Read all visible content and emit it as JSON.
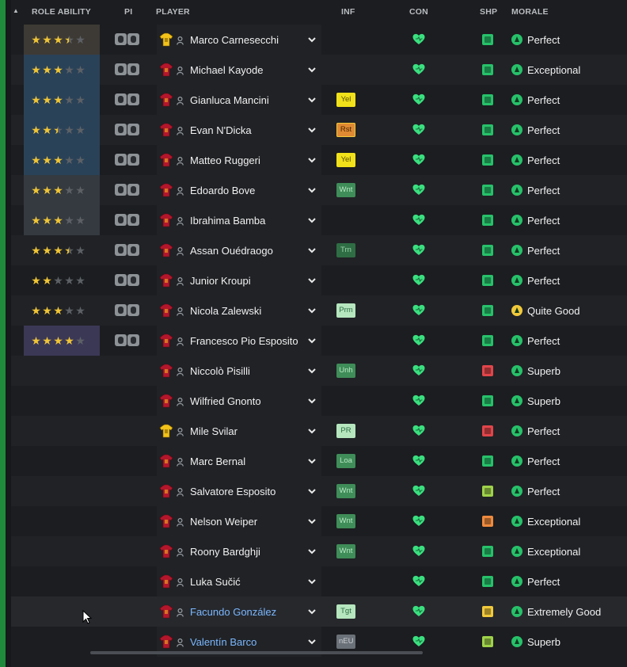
{
  "header": {
    "sort_indicator": "▲",
    "role_ability": "ROLE ABILITY",
    "pi": "PI",
    "player": "PLAYER",
    "inf": "INF",
    "con": "CON",
    "shp": "SHP",
    "morale": "MORALE"
  },
  "players": [
    {
      "name": "Marco Carnesecchi",
      "stars": 3.5,
      "ra_tint": "brown",
      "kit": "gk",
      "inf": null,
      "inf_style": null,
      "shp": "good",
      "morale": "Perfect",
      "morale_icon": "green"
    },
    {
      "name": "Michael Kayode",
      "stars": 3,
      "ra_tint": "blue",
      "kit": "outfield",
      "inf": null,
      "inf_style": null,
      "shp": "good",
      "morale": "Exceptional",
      "morale_icon": "green"
    },
    {
      "name": "Gianluca Mancini",
      "stars": 3,
      "ra_tint": "blue",
      "kit": "outfield",
      "inf": "Yel",
      "inf_style": "yellow",
      "shp": "good",
      "morale": "Perfect",
      "morale_icon": "green"
    },
    {
      "name": "Evan N'Dicka",
      "stars": 2.5,
      "ra_tint": "blue",
      "kit": "outfield",
      "inf": "Rst",
      "inf_style": "orange",
      "shp": "good",
      "morale": "Perfect",
      "morale_icon": "green"
    },
    {
      "name": "Matteo Ruggeri",
      "stars": 3,
      "ra_tint": "blue",
      "kit": "outfield",
      "inf": "Yel",
      "inf_style": "yellow",
      "shp": "good",
      "morale": "Perfect",
      "morale_icon": "green"
    },
    {
      "name": "Edoardo Bove",
      "stars": 3,
      "ra_tint": "grey",
      "kit": "outfield",
      "inf": "Wnt",
      "inf_style": "green",
      "shp": "good",
      "morale": "Perfect",
      "morale_icon": "green"
    },
    {
      "name": "Ibrahima Bamba",
      "stars": 3,
      "ra_tint": "grey",
      "kit": "outfield",
      "inf": null,
      "inf_style": null,
      "shp": "good",
      "morale": "Perfect",
      "morale_icon": "green"
    },
    {
      "name": "Assan Ouédraogo",
      "stars": 3.5,
      "ra_tint": "none",
      "kit": "outfield",
      "inf": "Trn",
      "inf_style": "darkgreen",
      "shp": "good",
      "morale": "Perfect",
      "morale_icon": "green"
    },
    {
      "name": "Junior Kroupi",
      "stars": 2,
      "ra_tint": "none",
      "kit": "outfield",
      "inf": null,
      "inf_style": null,
      "shp": "good",
      "morale": "Perfect",
      "morale_icon": "green"
    },
    {
      "name": "Nicola Zalewski",
      "stars": 3,
      "ra_tint": "none",
      "kit": "outfield",
      "inf": "Prm",
      "inf_style": "lightgreen",
      "shp": "good",
      "morale": "Quite Good",
      "morale_icon": "yellow"
    },
    {
      "name": "Francesco Pio Esposito",
      "stars": 4,
      "ra_tint": "purple",
      "kit": "outfield",
      "inf": null,
      "inf_style": null,
      "shp": "good",
      "morale": "Perfect",
      "morale_icon": "green"
    },
    {
      "name": "Niccolò Pisilli",
      "stars": 0,
      "ra_tint": "none",
      "kit": "outfield",
      "inf": "Unh",
      "inf_style": "green",
      "shp": "bad",
      "morale": "Superb",
      "morale_icon": "green"
    },
    {
      "name": "Wilfried Gnonto",
      "stars": 0,
      "ra_tint": "none",
      "kit": "outfield",
      "inf": null,
      "inf_style": null,
      "shp": "good",
      "morale": "Superb",
      "morale_icon": "green"
    },
    {
      "name": "Mile Svilar",
      "stars": 0,
      "ra_tint": "none",
      "kit": "gk",
      "inf": "PR",
      "inf_style": "lightgreen",
      "shp": "bad",
      "morale": "Perfect",
      "morale_icon": "green"
    },
    {
      "name": "Marc Bernal",
      "stars": 0,
      "ra_tint": "none",
      "kit": "outfield",
      "inf": "Loa",
      "inf_style": "green",
      "shp": "good",
      "morale": "Perfect",
      "morale_icon": "green"
    },
    {
      "name": "Salvatore Esposito",
      "stars": 0,
      "ra_tint": "none",
      "kit": "outfield",
      "inf": "Wnt",
      "inf_style": "green",
      "shp": "ok",
      "morale": "Perfect",
      "morale_icon": "green"
    },
    {
      "name": "Nelson Weiper",
      "stars": 0,
      "ra_tint": "none",
      "kit": "outfield",
      "inf": "Wnt",
      "inf_style": "green",
      "shp": "warn",
      "morale": "Exceptional",
      "morale_icon": "green"
    },
    {
      "name": "Roony Bardghji",
      "stars": 0,
      "ra_tint": "none",
      "kit": "outfield",
      "inf": "Wnt",
      "inf_style": "green",
      "shp": "good",
      "morale": "Exceptional",
      "morale_icon": "green"
    },
    {
      "name": "Luka Sučić",
      "stars": 0,
      "ra_tint": "none",
      "kit": "outfield",
      "inf": null,
      "inf_style": null,
      "shp": "good",
      "morale": "Perfect",
      "morale_icon": "green"
    },
    {
      "name": "Facundo González",
      "stars": 0,
      "ra_tint": "none",
      "kit": "outfield",
      "inf": "Tgt",
      "inf_style": "lightgreen",
      "shp": "meh",
      "morale": "Extremely Good",
      "morale_icon": "green",
      "link": true
    },
    {
      "name": "Valentín Barco",
      "stars": 0,
      "ra_tint": "none",
      "kit": "outfield",
      "inf": "nEU",
      "inf_style": "grey",
      "shp": "ok",
      "morale": "Superb",
      "morale_icon": "green",
      "link": true
    }
  ],
  "colors": {
    "accent_green": "#1f8a3c",
    "star": "#f0c536",
    "heart": "#3ae07f"
  }
}
